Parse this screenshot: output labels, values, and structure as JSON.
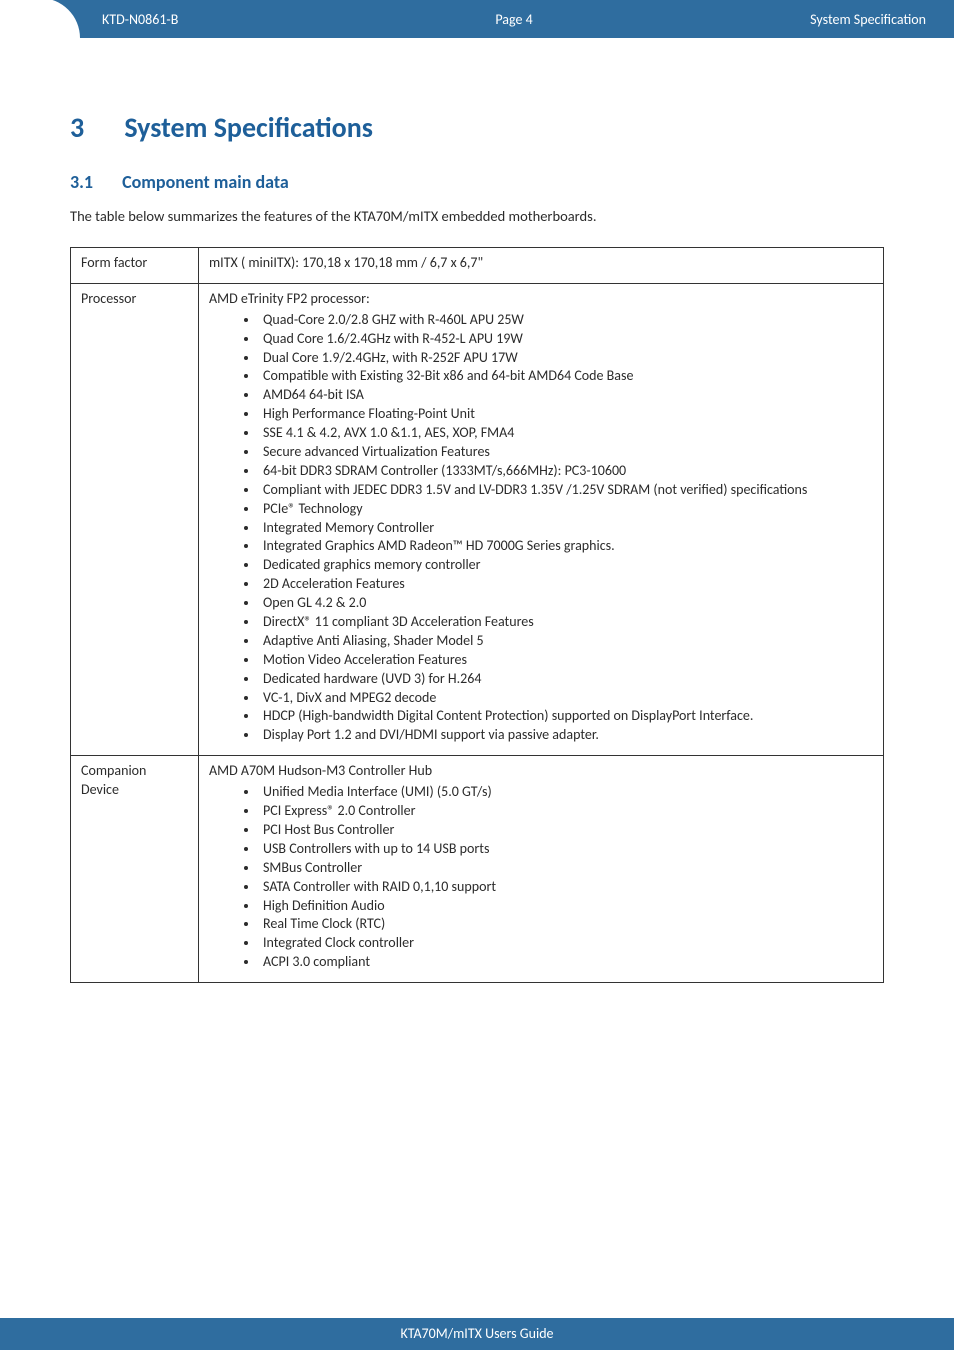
{
  "header": {
    "doc_id": "KTD-N0861-B",
    "page_label": "Page 4",
    "section": "System Specification"
  },
  "footer": {
    "text": "KTA70M/mITX Users Guide"
  },
  "title": {
    "num": "3",
    "text": "System Specifications"
  },
  "subtitle": {
    "num": "3.1",
    "text": "Component main data"
  },
  "intro": "The table below summarizes the features of the KTA70M/mITX embedded motherboards.",
  "rows": {
    "form_factor": {
      "label": "Form factor",
      "value": "mITX ( miniITX): 170,18 x 170,18 mm / 6,7 x 6,7\""
    },
    "processor": {
      "label": "Processor",
      "lead": "AMD eTrinity FP2 processor:",
      "items": [
        "Quad-Core 2.0/2.8 GHZ with R-460L APU 25W",
        "Quad Core 1.6/2.4GHz with R-452-L APU 19W",
        "Dual Core 1.9/2.4GHz, with R-252F APU 17W",
        "Compatible with Existing 32-Bit x86 and 64-bit AMD64 Code Base",
        "AMD64 64-bit ISA",
        "High Performance Floating-Point Unit",
        "SSE 4.1 & 4.2, AVX 1.0 &1.1, AES, XOP, FMA4",
        "Secure advanced Virtualization Features",
        "64-bit DDR3 SDRAM Controller (1333MT/s,666MHz): PC3-10600",
        "Compliant with JEDEC DDR3 1.5V and LV-DDR3 1.35V /1.25V SDRAM (not verified) specifications",
        "PCIe® Technology",
        "Integrated Memory Controller",
        "Integrated Graphics AMD Radeon™ HD 7000G Series graphics.",
        "Dedicated graphics memory controller",
        "2D Acceleration Features",
        "Open GL 4.2 & 2.0",
        "DirectX® 11 compliant 3D Acceleration Features",
        "Adaptive Anti Aliasing, Shader Model 5",
        "Motion Video Acceleration Features",
        "Dedicated hardware (UVD 3) for H.264",
        "VC-1, DivX and MPEG2 decode",
        "HDCP (High-bandwidth Digital Content Protection) supported on DisplayPort Interface.",
        "Display Port 1.2 and DVI/HDMI support via passive adapter."
      ]
    },
    "companion": {
      "label_l1": "Companion",
      "label_l2": "Device",
      "lead": "AMD A70M Hudson-M3 Controller Hub",
      "items": [
        "Unified Media Interface (UMI) (5.0 GT/s)",
        "PCI Express® 2.0 Controller",
        "PCI Host Bus Controller",
        "USB Controllers with up to 14 USB ports",
        "SMBus Controller",
        "SATA Controller with RAID 0,1,10 support",
        "High Definition Audio",
        "Real Time Clock (RTC)",
        "Integrated Clock controller",
        "ACPI 3.0 compliant"
      ]
    }
  }
}
